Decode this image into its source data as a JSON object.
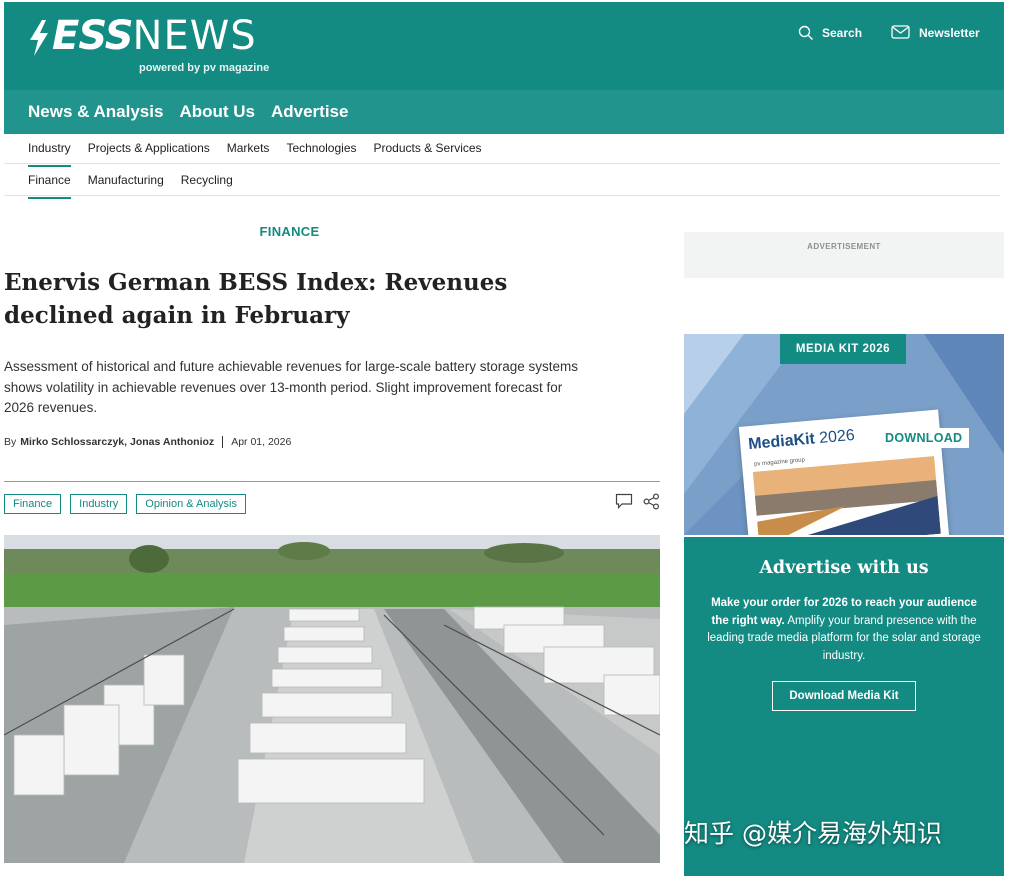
{
  "brand": {
    "logo_ess": "ESS",
    "logo_news": "NEWS",
    "tagline": "powered by pv magazine"
  },
  "header": {
    "search_label": "Search",
    "newsletter_label": "Newsletter"
  },
  "main_nav": [
    "News & Analysis",
    "About Us",
    "Advertise"
  ],
  "sub_nav_1": [
    "Industry",
    "Projects & Applications",
    "Markets",
    "Technologies",
    "Products & Services"
  ],
  "sub_nav_2": [
    "Finance",
    "Manufacturing",
    "Recycling"
  ],
  "article": {
    "category": "FINANCE",
    "title": "Enervis German BESS Index: Revenues declined again in February",
    "lead": "Assessment of historical and future achievable revenues for large-scale battery storage systems shows volatility in achievable revenues over 13-month period. Slight improvement forecast for 2026 revenues.",
    "by_label": "By",
    "authors": "Mirko Schlossarczyk, Jonas Anthonioz",
    "date": "Apr 01, 2026",
    "tags": [
      "Finance",
      "Industry",
      "Opinion & Analysis"
    ]
  },
  "sidebar": {
    "ad_label": "ADVERTISEMENT",
    "mediakit_badge": "MEDIA KIT 2026",
    "mediakit_card_title": "MediaKit",
    "mediakit_card_year": "2026",
    "mediakit_card_sub": "pv magazine group",
    "mediakit_download": "DOWNLOAD",
    "advertise_title": "Advertise with us",
    "advertise_text_bold": "Make your order for 2026 to reach your audience the right way.",
    "advertise_text": "Amplify your brand presence with the leading trade media platform for the solar and storage industry.",
    "advertise_button": "Download Media Kit"
  },
  "watermark": "知乎 @媒介易海外知识",
  "colors": {
    "brand_teal": "#138a82",
    "nav_teal": "#21958d"
  },
  "icons": [
    "search-icon",
    "newsletter-icon",
    "comment-icon",
    "share-icon"
  ]
}
